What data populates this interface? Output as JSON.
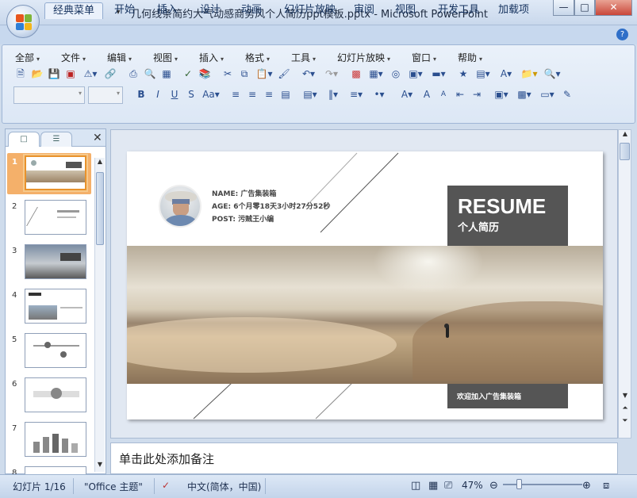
{
  "window": {
    "title": "几何线条简约大气动感商务风个人简历ppt模板.pptx - Microsoft PowerPoint",
    "controls": {
      "minimize": "—",
      "maximize": "□",
      "close": "✕"
    }
  },
  "quick_access": {
    "save": "save-icon",
    "undo": "undo-icon",
    "redo": "redo-icon",
    "customize": "▾"
  },
  "tabs": [
    "经典菜单",
    "开始",
    "插入",
    "设计",
    "动画",
    "幻灯片放映",
    "审阅",
    "视图",
    "开发工具",
    "加载项"
  ],
  "menus": [
    "全部",
    "文件",
    "编辑",
    "视图",
    "插入",
    "格式",
    "工具",
    "幻灯片放映",
    "窗口",
    "帮助"
  ],
  "slide": {
    "name_line": "NAME: 广告集装箱",
    "age_line": "AGE: 6个月零18天3小时27分52秒",
    "post_line": "POST: 污贼王小编",
    "resume_title": "RESUME",
    "resume_subtitle": "个人简历",
    "welcome": "欢迎加入广告集装箱"
  },
  "slide_numbers": [
    "1",
    "2",
    "3",
    "4",
    "5",
    "6",
    "7",
    "8"
  ],
  "notes_placeholder": "单击此处添加备注",
  "status": {
    "slide_info": "幻灯片 1/16",
    "theme": "\"Office 主题\"",
    "language": "中文(简体，中国)",
    "zoom": "47%"
  },
  "colors": {
    "accent_orange": "#e8922c",
    "resume_box": "#555555",
    "welcome_box": "#555555"
  }
}
